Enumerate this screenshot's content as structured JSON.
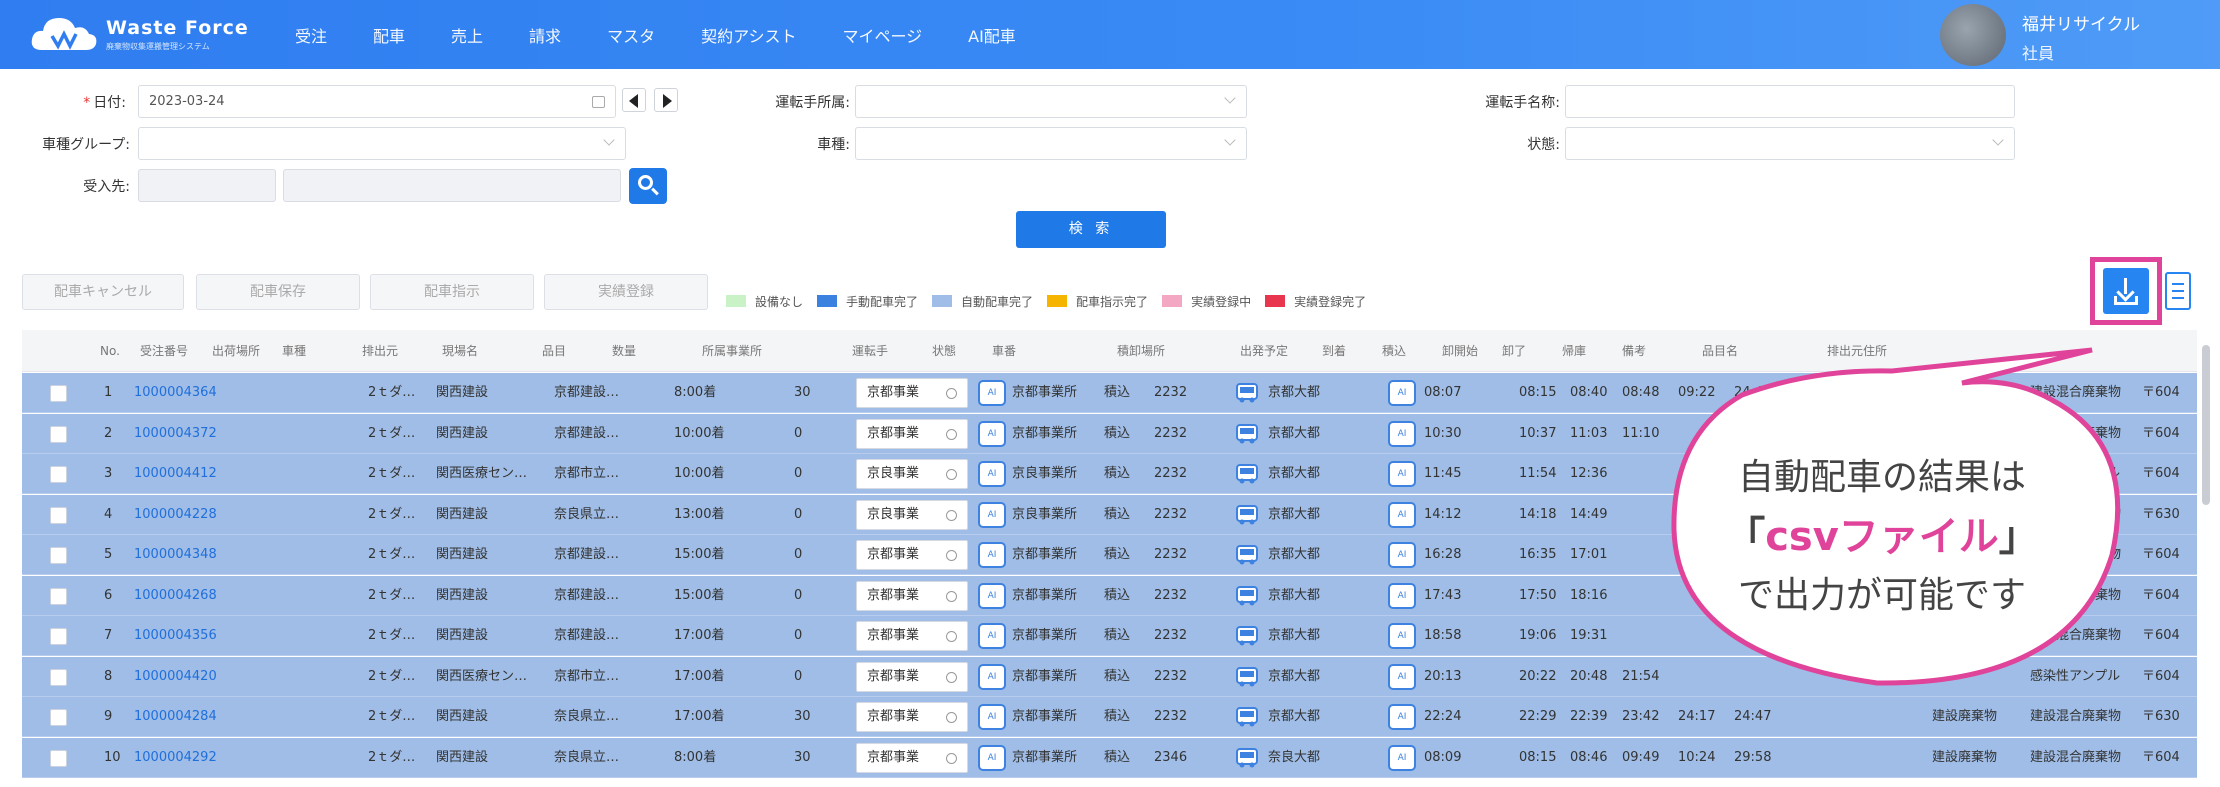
{
  "header": {
    "app_name": "Waste Force",
    "app_sub": "廃棄物収集運搬管理システム",
    "nav": [
      "受注",
      "配車",
      "売上",
      "請求",
      "マスタ",
      "契約アシスト",
      "マイページ",
      "AI配車"
    ],
    "user_name": "福井リサイクル",
    "user_sub": "社員"
  },
  "filters": {
    "date_label": "日付:",
    "date_value": "2023-03-24",
    "vehicle_group_label": "車種グループ:",
    "receiver_label": "受入先:",
    "driver_office_label": "運転手所属:",
    "vehicle_type_label": "車種:",
    "driver_name_label": "運転手名称:",
    "status_label": "状態:",
    "search_button": "検 索"
  },
  "actions": {
    "cancel": "配車キャンセル",
    "save": "配車保存",
    "instruct": "配車指示",
    "record": "実績登録"
  },
  "legend": [
    {
      "label": "設備なし",
      "color": "#c9f2c7"
    },
    {
      "label": "手動配車完了",
      "color": "#3b82e0"
    },
    {
      "label": "自動配車完了",
      "color": "#9fbde6"
    },
    {
      "label": "配車指示完了",
      "color": "#f5b400"
    },
    {
      "label": "実績登録中",
      "color": "#f4a7c3"
    },
    {
      "label": "実績登録完了",
      "color": "#e8364e"
    }
  ],
  "table": {
    "headers": [
      "No.",
      "受注番号",
      "出荷場所",
      "車種",
      "排出元",
      "現場名",
      "品目",
      "数量",
      "所属事業所",
      "",
      "運転手",
      "状態",
      "車番",
      "",
      "積卸場所",
      "",
      "出発予定",
      "到着",
      "積込",
      "卸開始",
      "卸了",
      "帰庫",
      "備考",
      "品目名",
      "排出元住所"
    ],
    "rows": [
      {
        "no": "1",
        "order": "1000004364",
        "vtype": "2ｔダ…",
        "client": "関西建設",
        "site": "京都建設…",
        "time": "8:00着",
        "qty": "30",
        "office": "京都事業",
        "badge": "AI",
        "driver": "京都事業所",
        "status": "積込",
        "car": "2232",
        "dest": "京都大都",
        "t1": "08:07",
        "t2": "08:15",
        "t3": "08:40",
        "t4": "08:48",
        "t5": "09:22",
        "t6": "24:47",
        "item": "建設廃棄物",
        "item2": "建設混合廃棄物",
        "addr": "〒604"
      },
      {
        "no": "2",
        "order": "1000004372",
        "vtype": "2ｔダ…",
        "client": "関西建設",
        "site": "京都建設…",
        "time": "10:00着",
        "qty": "0",
        "office": "京都事業",
        "badge": "AI",
        "driver": "京都事業所",
        "status": "積込",
        "car": "2232",
        "dest": "京都大都",
        "t1": "10:30",
        "t2": "10:37",
        "t3": "11:03",
        "t4": "11:10",
        "t5": "",
        "t6": "",
        "item": "",
        "item2": "建設混合廃棄物",
        "addr": "〒604"
      },
      {
        "no": "3",
        "order": "1000004412",
        "vtype": "2ｔダ…",
        "client": "関西医療セン…",
        "site": "京都市立…",
        "time": "10:00着",
        "qty": "0",
        "office": "京良事業",
        "badge": "AI",
        "driver": "京良事業所",
        "status": "積込",
        "car": "2232",
        "dest": "京都大都",
        "t1": "11:45",
        "t2": "11:54",
        "t3": "12:36",
        "t4": "",
        "t5": "",
        "t6": "",
        "item": "",
        "item2": "感染性アンプル",
        "addr": "〒604"
      },
      {
        "no": "4",
        "order": "1000004228",
        "vtype": "2ｔダ…",
        "client": "関西建設",
        "site": "奈良県立…",
        "time": "13:00着",
        "qty": "0",
        "office": "京良事業",
        "badge": "AI",
        "driver": "京良事業所",
        "status": "積込",
        "car": "2232",
        "dest": "京都大都",
        "t1": "14:12",
        "t2": "14:18",
        "t3": "14:49",
        "t4": "",
        "t5": "",
        "t6": "",
        "item": "",
        "item2": "建設混合廃棄物",
        "addr": "〒630"
      },
      {
        "no": "5",
        "order": "1000004348",
        "vtype": "2ｔダ…",
        "client": "関西建設",
        "site": "京都建設…",
        "time": "15:00着",
        "qty": "0",
        "office": "京都事業",
        "badge": "AI",
        "driver": "京都事業所",
        "status": "積込",
        "car": "2232",
        "dest": "京都大都",
        "t1": "16:28",
        "t2": "16:35",
        "t3": "17:01",
        "t4": "",
        "t5": "",
        "t6": "",
        "item": "",
        "item2": "建設混合廃棄物",
        "addr": "〒604"
      },
      {
        "no": "6",
        "order": "1000004268",
        "vtype": "2ｔダ…",
        "client": "関西建設",
        "site": "京都建設…",
        "time": "15:00着",
        "qty": "0",
        "office": "京都事業",
        "badge": "AI",
        "driver": "京都事業所",
        "status": "積込",
        "car": "2232",
        "dest": "京都大都",
        "t1": "17:43",
        "t2": "17:50",
        "t3": "18:16",
        "t4": "",
        "t5": "",
        "t6": "",
        "item": "",
        "item2": "建設混合廃棄物",
        "addr": "〒604"
      },
      {
        "no": "7",
        "order": "1000004356",
        "vtype": "2ｔダ…",
        "client": "関西建設",
        "site": "京都建設…",
        "time": "17:00着",
        "qty": "0",
        "office": "京都事業",
        "badge": "AI",
        "driver": "京都事業所",
        "status": "積込",
        "car": "2232",
        "dest": "京都大都",
        "t1": "18:58",
        "t2": "19:06",
        "t3": "19:31",
        "t4": "",
        "t5": "",
        "t6": "",
        "item": "",
        "item2": "建設混合廃棄物",
        "addr": "〒604"
      },
      {
        "no": "8",
        "order": "1000004420",
        "vtype": "2ｔダ…",
        "client": "関西医療セン…",
        "site": "京都市立…",
        "time": "17:00着",
        "qty": "0",
        "office": "京都事業",
        "badge": "AI",
        "driver": "京都事業所",
        "status": "積込",
        "car": "2232",
        "dest": "京都大都",
        "t1": "20:13",
        "t2": "20:22",
        "t3": "20:48",
        "t4": "21:54",
        "t5": "",
        "t6": "",
        "item": "",
        "item2": "感染性アンプル",
        "addr": "〒604"
      },
      {
        "no": "9",
        "order": "1000004284",
        "vtype": "2ｔダ…",
        "client": "関西建設",
        "site": "奈良県立…",
        "time": "17:00着",
        "qty": "30",
        "office": "京都事業",
        "badge": "AI",
        "driver": "京都事業所",
        "status": "積込",
        "car": "2232",
        "dest": "京都大都",
        "t1": "22:24",
        "t2": "22:29",
        "t3": "22:39",
        "t4": "23:42",
        "t5": "24:17",
        "t6": "24:47",
        "item": "建設廃棄物",
        "item2": "建設混合廃棄物",
        "addr": "〒630"
      },
      {
        "no": "10",
        "order": "1000004292",
        "vtype": "2ｔダ…",
        "client": "関西建設",
        "site": "奈良県立…",
        "time": "8:00着",
        "qty": "30",
        "office": "京都事業",
        "badge": "AI",
        "driver": "京都事業所",
        "status": "積込",
        "car": "2346",
        "dest": "奈良大都",
        "t1": "08:09",
        "t2": "08:15",
        "t3": "08:46",
        "t4": "09:49",
        "t5": "10:24",
        "t6": "29:58",
        "item": "建設廃棄物",
        "item2": "建設混合廃棄物",
        "addr": "〒604"
      }
    ]
  },
  "callout": {
    "line1": "自動配車の結果は",
    "line2_open": "「",
    "line2_highlight": "csvファイル",
    "line2_close": "」",
    "line3": "で出力が可能です"
  }
}
